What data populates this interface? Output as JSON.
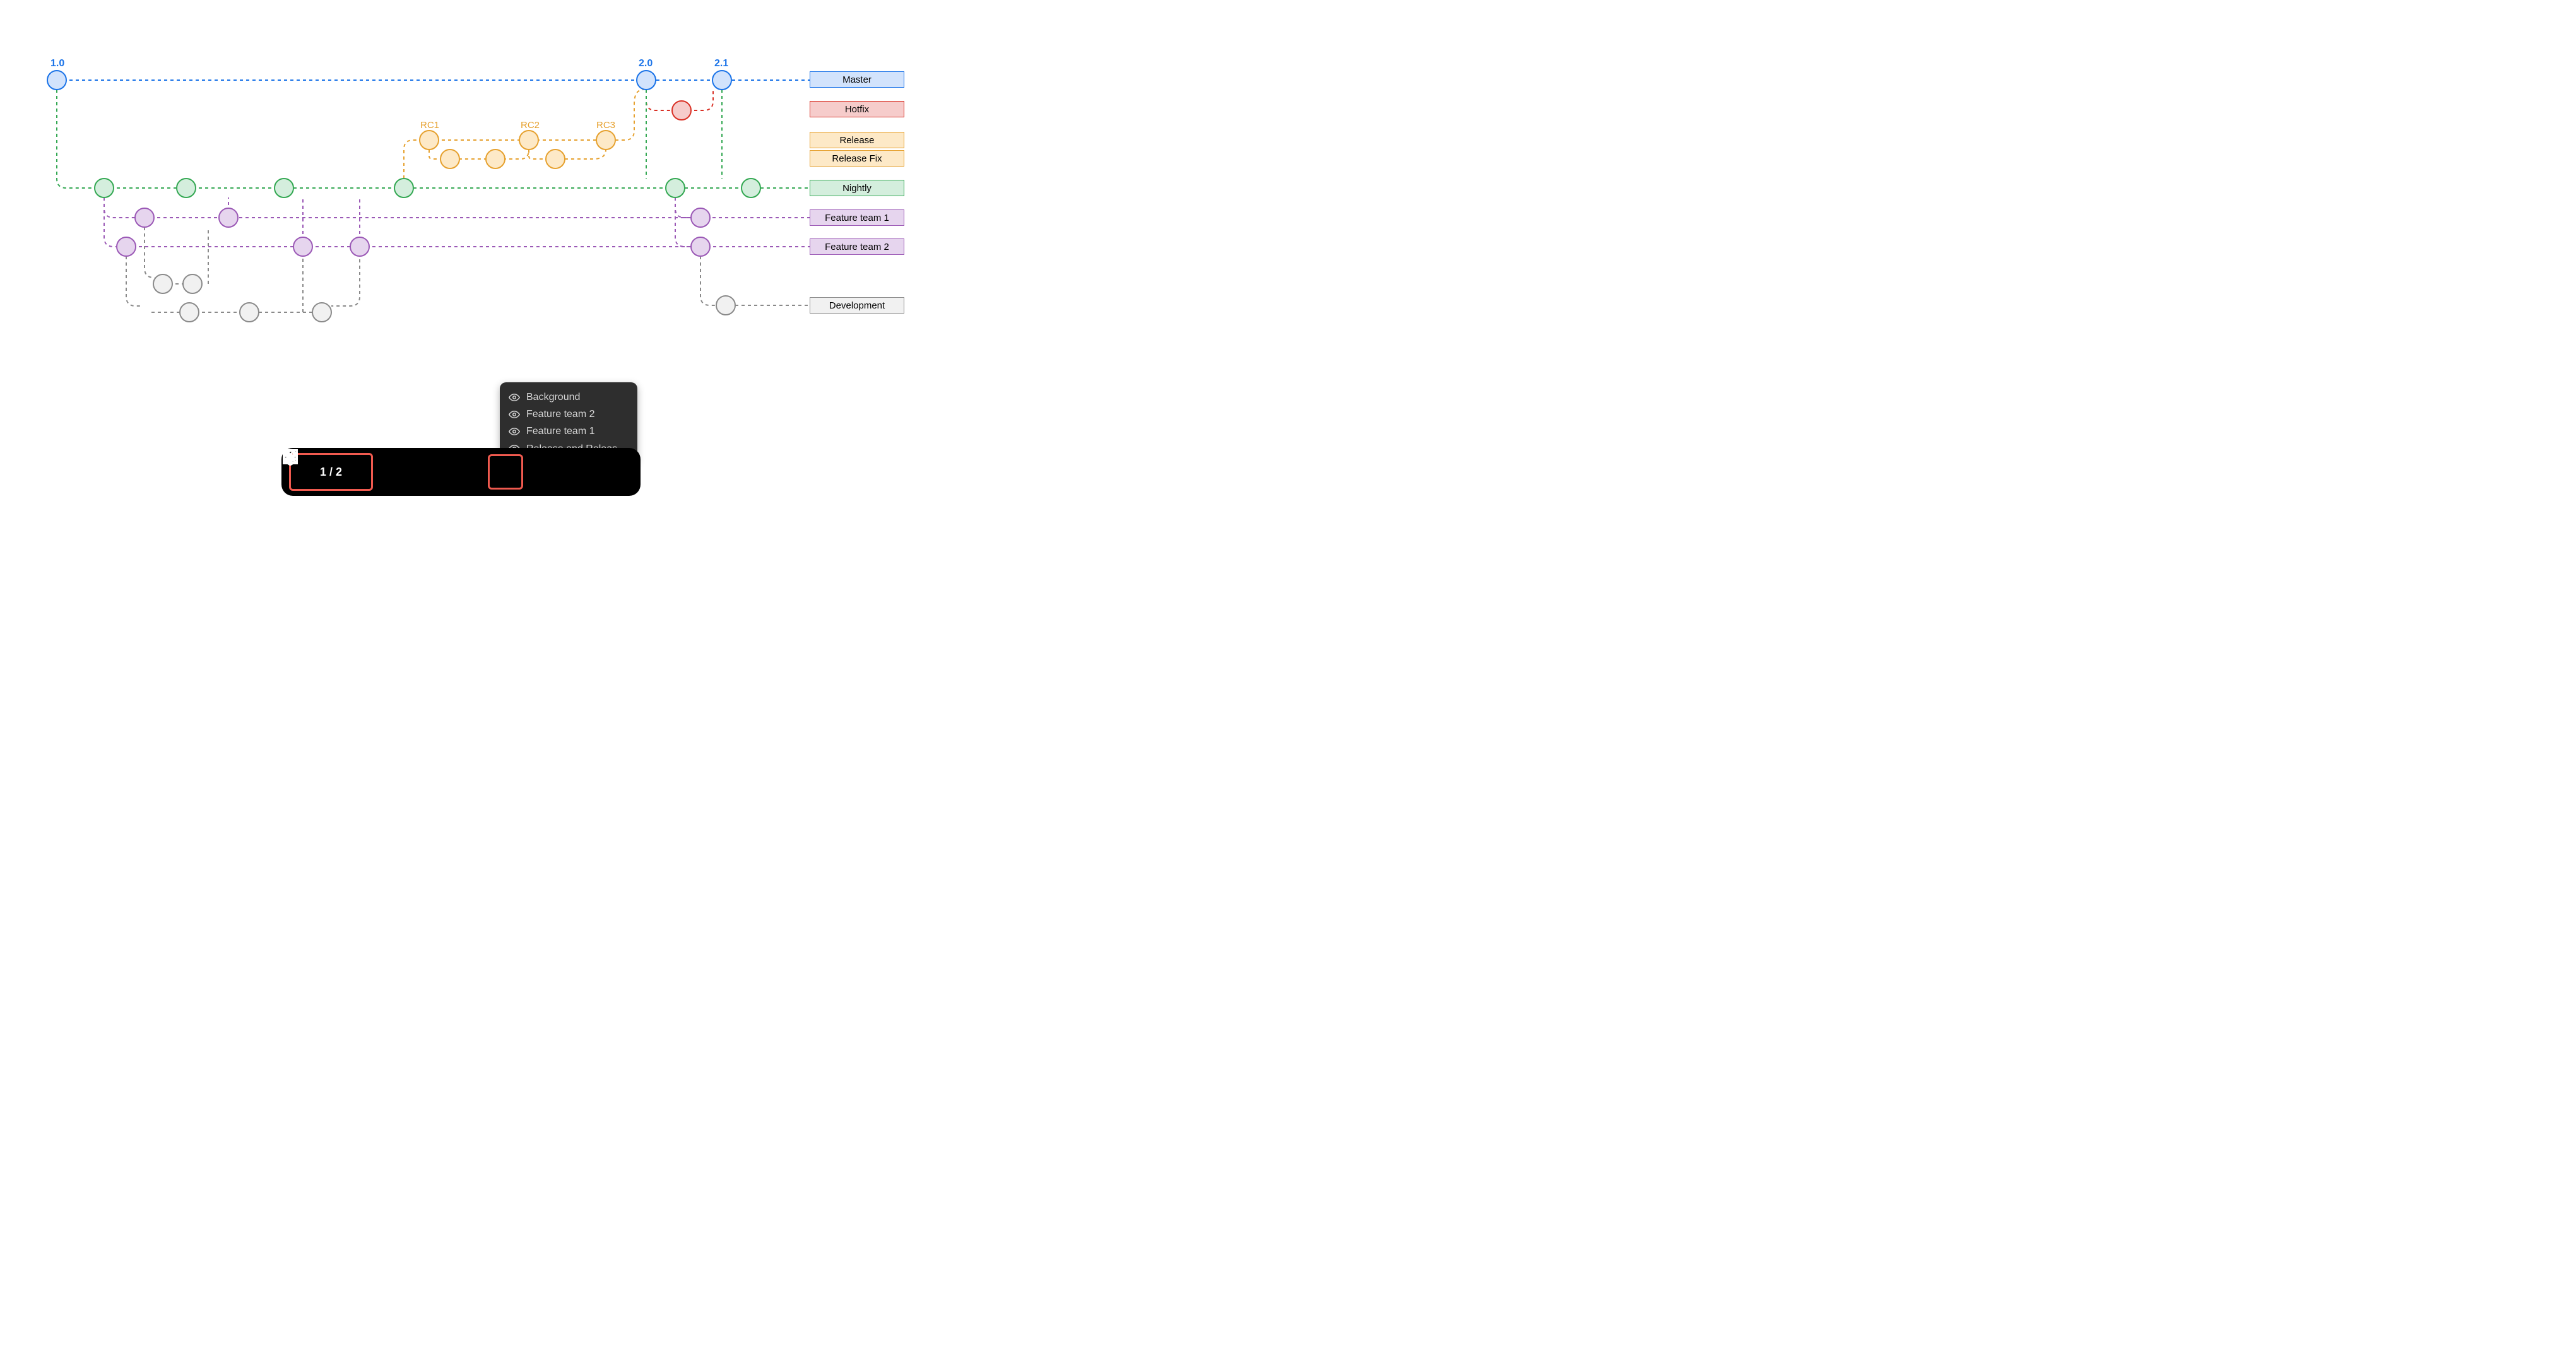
{
  "versions": {
    "v1": "1.0",
    "v2": "2.0",
    "v3": "2.1"
  },
  "rc": {
    "rc1": "RC1",
    "rc2": "RC2",
    "rc3": "RC3"
  },
  "branches": {
    "master": "Master",
    "hotfix": "Hotfix",
    "release": "Release",
    "releasefix": "Release Fix",
    "nightly": "Nightly",
    "ft1": "Feature team 1",
    "ft2": "Feature team 2",
    "dev": "Development"
  },
  "layers": {
    "l0": "Background",
    "l1": "Feature team 2",
    "l2": "Feature team 1",
    "l3": "Release and Releas…"
  },
  "toolbar": {
    "page": "1 / 2"
  },
  "colors": {
    "blue": "#1a73e8",
    "blueFill": "#d2e3fc",
    "red": "#d93025",
    "redFill": "#f6cccb",
    "orange": "#e6a12f",
    "orangeFill": "#fde9c7",
    "green": "#34a853",
    "greenFill": "#d4eedd",
    "purple": "#9b59b6",
    "purpleFill": "#e6d5ee",
    "gray": "#8a8a8a",
    "grayFill": "#f1f1f1"
  }
}
